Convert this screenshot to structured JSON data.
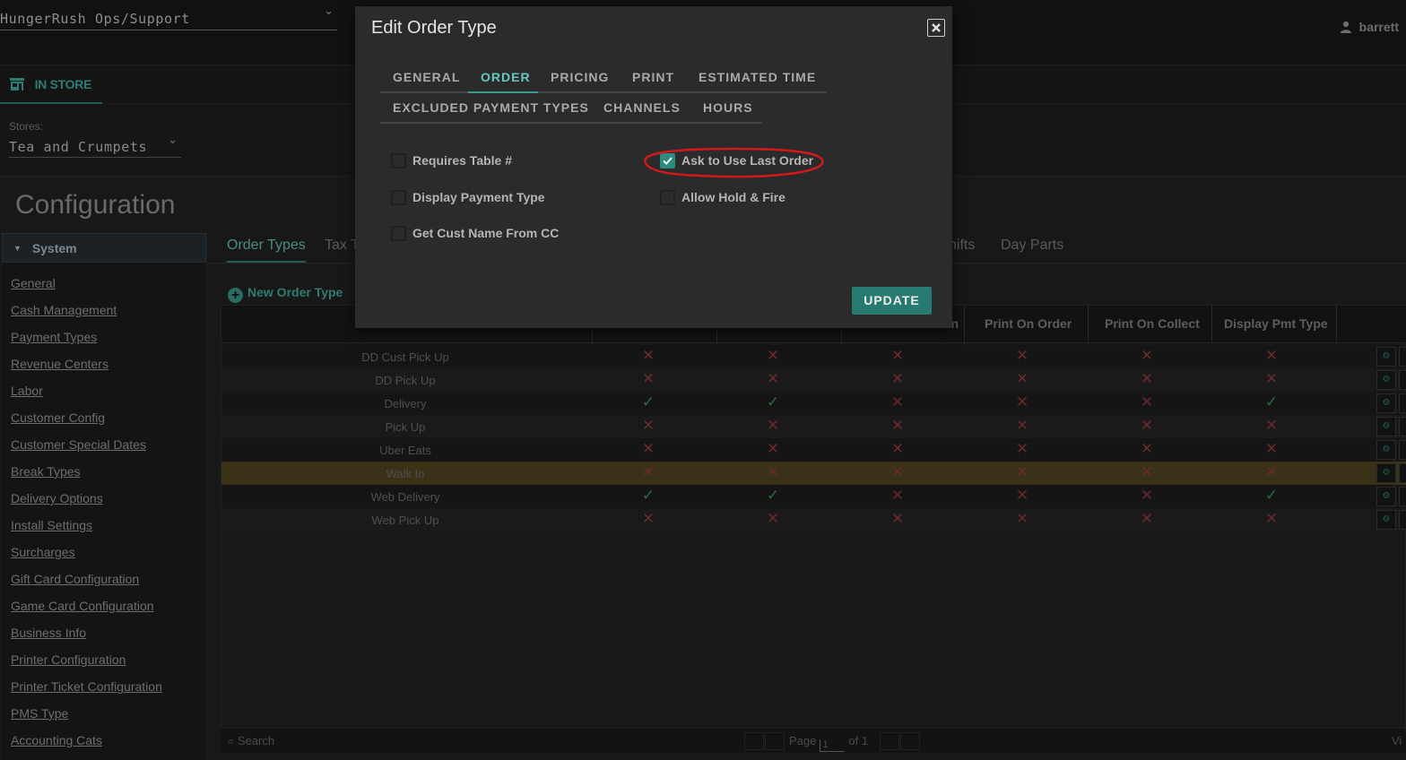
{
  "topbar": {
    "org": "HungerRush Ops/Support",
    "user": "barrett"
  },
  "instore": {
    "label": "IN STORE"
  },
  "stores": {
    "label": "Stores:",
    "value": "Tea and Crumpets"
  },
  "config": {
    "title": "Configuration"
  },
  "sidebar": {
    "section": "System",
    "items": [
      "General",
      "Cash Management",
      "Payment Types",
      "Revenue Centers",
      "Labor",
      "Customer Config",
      "Customer Special Dates",
      "Break Types",
      "Delivery Options",
      "Install Settings",
      "Surcharges",
      "Gift Card Configuration",
      "Game Card Configuration",
      "Business Info",
      "Printer Configuration",
      "Printer Ticket Configuration",
      "PMS Type",
      "Accounting Cats"
    ]
  },
  "tabs": {
    "order_types": "Order Types",
    "tax": "Tax T",
    "shifts": "hifts",
    "day_parts": "Day Parts"
  },
  "new_order_type": "New Order Type",
  "grid": {
    "headers": {
      "c4": "n",
      "c5": "Print On Order",
      "c6": "Print On Collect",
      "c7": "Display Pmt Type"
    },
    "rows": [
      {
        "name": "DD Cust Pick Up",
        "marks": [
          "x",
          "x",
          "x",
          "x",
          "x",
          "x"
        ]
      },
      {
        "name": "DD Pick Up",
        "marks": [
          "x",
          "x",
          "x",
          "x",
          "x",
          "x"
        ]
      },
      {
        "name": "Delivery",
        "marks": [
          "ok",
          "ok",
          "x",
          "x",
          "x",
          "ok"
        ]
      },
      {
        "name": "Pick Up",
        "marks": [
          "x",
          "x",
          "x",
          "x",
          "x",
          "x"
        ]
      },
      {
        "name": "Uber Eats",
        "marks": [
          "x",
          "x",
          "x",
          "x",
          "x",
          "x"
        ]
      },
      {
        "name": "Walk In",
        "marks": [
          "x",
          "x",
          "x",
          "x",
          "x",
          "x"
        ],
        "selected": true
      },
      {
        "name": "Web Delivery",
        "marks": [
          "ok",
          "ok",
          "x",
          "x",
          "x",
          "ok"
        ]
      },
      {
        "name": "Web Pick Up",
        "marks": [
          "x",
          "x",
          "x",
          "x",
          "x",
          "x"
        ]
      }
    ]
  },
  "pager": {
    "search": "Search",
    "page_label": "Page",
    "page_value": "1",
    "of": "of 1",
    "view": "Vi"
  },
  "modal": {
    "title": "Edit Order Type",
    "tabs_row1": [
      "GENERAL",
      "ORDER",
      "PRICING",
      "PRINT",
      "ESTIMATED TIME"
    ],
    "tabs_row2": [
      "EXCLUDED PAYMENT TYPES",
      "CHANNELS",
      "HOURS"
    ],
    "active_tab": "ORDER",
    "options": {
      "requires_table": {
        "label": "Requires Table #",
        "checked": false
      },
      "display_payment_type": {
        "label": "Display Payment Type",
        "checked": false
      },
      "get_cust_name": {
        "label": "Get Cust Name From CC",
        "checked": false
      },
      "ask_last_order": {
        "label": "Ask to Use Last Order",
        "checked": true
      },
      "allow_hold_fire": {
        "label": "Allow Hold & Fire",
        "checked": false
      }
    },
    "update_label": "UPDATE"
  },
  "colors": {
    "accent": "#2e8b80",
    "annotation": "#d21a1a",
    "x_mark": "#6a2a2a",
    "ok_mark": "#2d6b3b"
  }
}
